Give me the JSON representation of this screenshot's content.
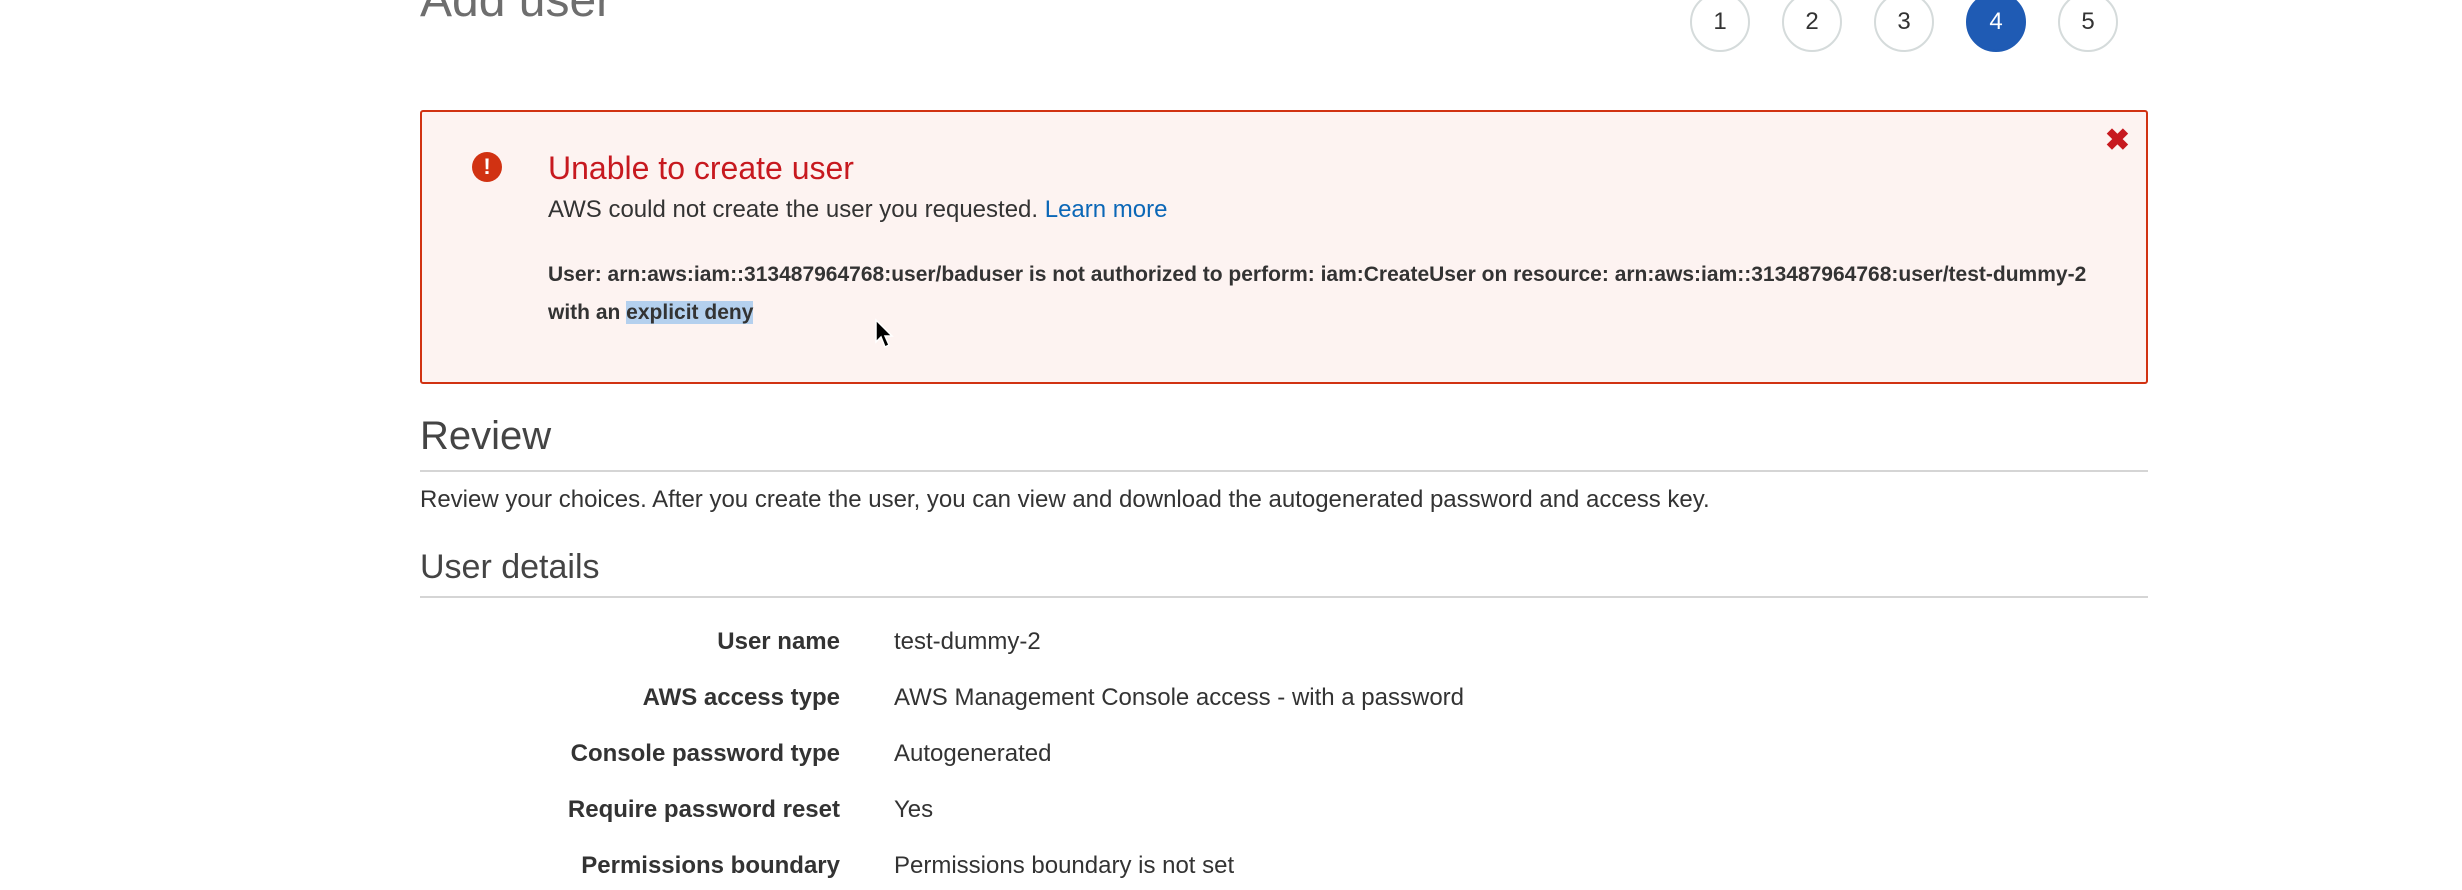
{
  "page": {
    "title": "Add user"
  },
  "steps": [
    "1",
    "2",
    "3",
    "4",
    "5"
  ],
  "active_step": "4",
  "alert": {
    "title": "Unable to create user",
    "subtitle": "AWS could not create the user you requested.",
    "learn_more": "Learn more",
    "detail_prefix": "User: arn:aws:iam::313487964768:user/baduser is not authorized to perform: iam:CreateUser on resource: arn:aws:iam::313487964768:user/test-dummy-2 with an ",
    "detail_highlight": "explicit deny",
    "close_glyph": "✖",
    "icon_glyph": "!"
  },
  "review": {
    "title": "Review",
    "description": "Review your choices. After you create the user, you can view and download the autogenerated password and access key."
  },
  "user_details": {
    "title": "User details",
    "rows": [
      {
        "label": "User name",
        "value": "test-dummy-2"
      },
      {
        "label": "AWS access type",
        "value": "AWS Management Console access - with a password"
      },
      {
        "label": "Console password type",
        "value": "Autogenerated"
      },
      {
        "label": "Require password reset",
        "value": "Yes"
      },
      {
        "label": "Permissions boundary",
        "value": "Permissions boundary is not set"
      }
    ]
  },
  "colors": {
    "error": "#d13212",
    "link": "#0b67b7",
    "active_step": "#1f5bb4"
  }
}
